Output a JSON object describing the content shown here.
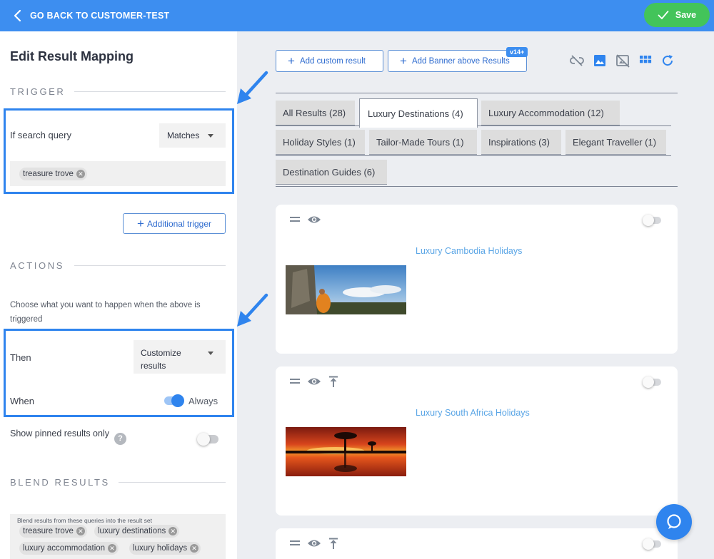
{
  "topbar": {
    "back_label": "GO BACK TO CUSTOMER-TEST",
    "save_label": "Save",
    "color": "#3d8ef0",
    "save_color": "#43c45a"
  },
  "left": {
    "title": "Edit Result Mapping",
    "trigger_heading": "TRIGGER",
    "if_label": "If search query",
    "match_select": "Matches",
    "trigger_chips": [
      "treasure trove"
    ],
    "additional_trigger": "Additional trigger",
    "actions_heading": "ACTIONS",
    "choose_text": "Choose what you want to happen when the above is triggered",
    "then_label": "Then",
    "then_select": "Customize results",
    "when_label": "When",
    "when_value": "Always",
    "when_toggle_on": true,
    "pinned_label": "Show pinned results only",
    "pinned_toggle_on": false,
    "help_glyph": "?",
    "blend_heading": "BLEND RESULTS",
    "blend_caption": "Blend results from these queries into the result set",
    "blend_chips": [
      "treasure trove",
      "luxury destinations",
      "luxury accommodation",
      "luxury holidays"
    ]
  },
  "toolbar": {
    "add_custom": "Add custom result",
    "add_banner": "Add Banner above Results",
    "version_badge": "v14+",
    "icons": [
      "unlink-icon",
      "image-icon",
      "hide-image-icon",
      "grid-icon",
      "refresh-icon"
    ]
  },
  "tabs": [
    {
      "label": "All Results (28)",
      "active": false
    },
    {
      "label": "Luxury Destinations (4)",
      "active": true
    },
    {
      "label": "Luxury Accommodation (12)",
      "active": false
    },
    {
      "label": "Holiday Styles (1)",
      "active": false
    },
    {
      "label": "Tailor-Made Tours (1)",
      "active": false
    },
    {
      "label": "Inspirations (3)",
      "active": false
    },
    {
      "label": "Elegant Traveller (1)",
      "active": false
    },
    {
      "label": "Destination Guides (6)",
      "active": false
    }
  ],
  "results": [
    {
      "title": "Luxury Cambodia Holidays",
      "pinnable": false
    },
    {
      "title": "Luxury South Africa Holidays",
      "pinnable": true
    },
    {
      "title": "",
      "pinnable": true
    }
  ],
  "colors": {
    "accent": "#2f84ee",
    "link": "#5ba6e6",
    "highlight_border": "#2f84ee"
  }
}
